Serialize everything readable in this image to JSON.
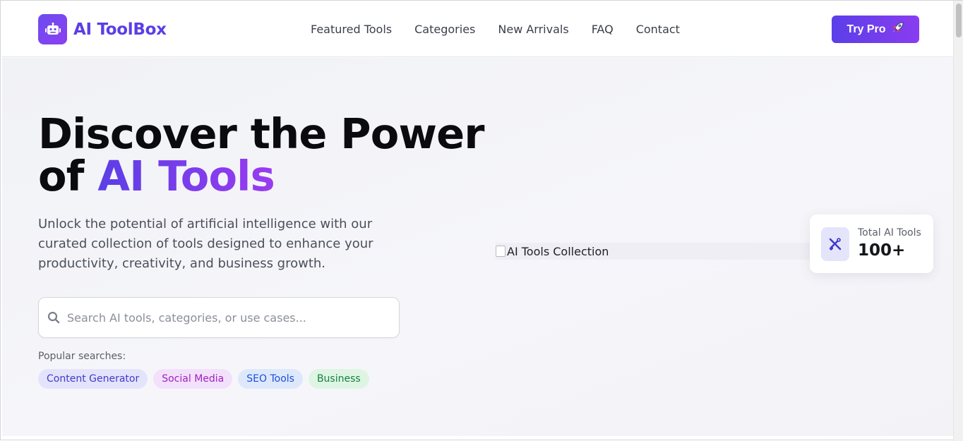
{
  "brand": {
    "name": "AI ToolBox",
    "icon": "robot-icon",
    "color": "#5b3ee6"
  },
  "nav": {
    "items": [
      "Featured Tools",
      "Categories",
      "New Arrivals",
      "FAQ",
      "Contact"
    ]
  },
  "header": {
    "cta_label": "Try Pro",
    "cta_icon": "rocket-icon"
  },
  "hero": {
    "title_line1": "Discover the Power",
    "title_line2_prefix": "of ",
    "title_accent": "AI Tools",
    "lead": "Unlock the potential of artificial intelligence with our curated collection of tools designed to enhance your productivity, creativity, and business growth.",
    "accent_gradient": [
      "#5b3ee6",
      "#9a3cf0"
    ]
  },
  "search": {
    "placeholder": "Search AI tools, categories, or use cases...",
    "value": "",
    "icon": "search-icon"
  },
  "popular": {
    "label": "Popular searches:",
    "chips": [
      "Content Generator",
      "Social Media",
      "SEO Tools",
      "Business"
    ]
  },
  "image": {
    "alt": "AI Tools Collection"
  },
  "stat": {
    "label": "Total AI Tools",
    "value": "100+",
    "icon": "tools-icon"
  }
}
